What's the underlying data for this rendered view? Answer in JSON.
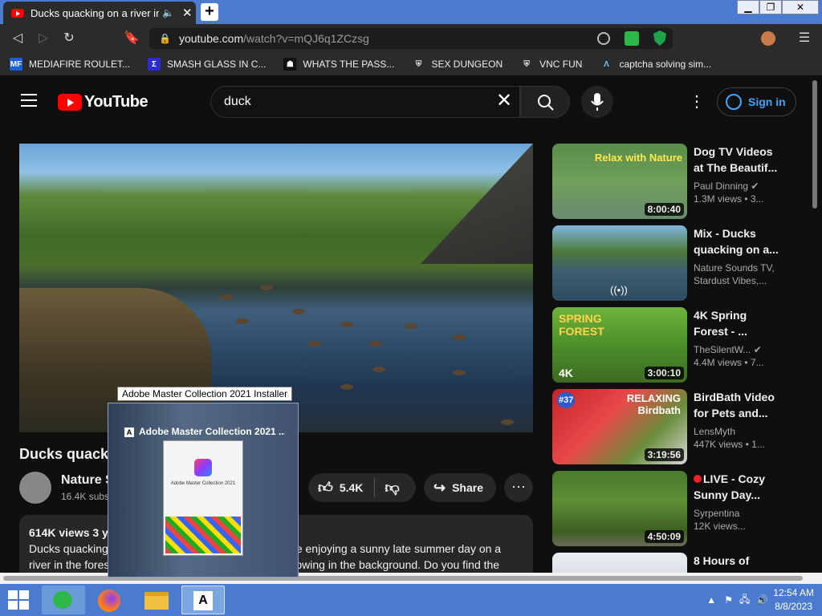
{
  "browser": {
    "tab_title": "Ducks quacking on a river in the forest",
    "url_main": "youtube.com",
    "url_path": "/watch?v=mQJ6q1ZCzsg",
    "bookmarks": [
      {
        "label": "MEDIAFIRE ROULET...",
        "icon": "MF"
      },
      {
        "label": "SMASH GLASS IN C...",
        "icon": "Σ"
      },
      {
        "label": "WHATS THE PASS...",
        "icon": "☗"
      },
      {
        "label": "SEX DUNGEON",
        "icon": "⛨"
      },
      {
        "label": "VNC FUN",
        "icon": "⛨"
      },
      {
        "label": "captcha solving sim...",
        "icon": "Λ"
      }
    ]
  },
  "youtube": {
    "logo_text": "YouTube",
    "search_value": "duck",
    "signin_label": "Sign in",
    "video": {
      "title": "Ducks quack",
      "channel": "Nature S",
      "subs": "16.4K subs",
      "likes": "5.4K",
      "share_label": "Share",
      "views_line": "614K views  3 y",
      "desc_line1": "Ducks quacking",
      "desc_line1b": "hile enjoying a sunny late summer day on a",
      "desc_line2": "river in the fores",
      "desc_line2b": "owing in the background. Do you find the"
    },
    "recommendations": [
      {
        "title": "Dog TV Videos at The Beautif...",
        "channel": "Paul Dinning",
        "views": "1.3M views  • 3...",
        "duration": "8:00:40",
        "overlay": "Relax with Nature",
        "verified": true
      },
      {
        "title": "Mix - Ducks quacking on a...",
        "channel": "Nature Sounds TV,",
        "channel2": "Stardust Vibes,...",
        "duration": "((•))",
        "overlay": ""
      },
      {
        "title": "4K Spring Forest - ...",
        "channel": "TheSilentW...",
        "views": "4.4M views  • 7...",
        "duration": "3:00:10",
        "overlay": "SPRING FOREST",
        "badge": "4K",
        "verified": true
      },
      {
        "title": "BirdBath Video for Pets and...",
        "channel": "LensMyth",
        "views": "447K views  • 1...",
        "duration": "3:19:56",
        "overlay": "RELAXING Birdbath",
        "badge": "#37"
      },
      {
        "title": "LIVE - Cozy Sunny Day...",
        "channel": "Syrpentina",
        "views": "12K views...",
        "duration": "4:50:09",
        "overlay": ""
      },
      {
        "title": "8 Hours of",
        "channel": "",
        "views": "",
        "duration": "",
        "overlay": ""
      }
    ]
  },
  "taskbar": {
    "tooltip": "Adobe Master Collection 2021 Installer",
    "preview_title": "Adobe Master Collection 2021 ...",
    "preview_window_text": "Adobe Master Collection 2021",
    "time": "12:54 AM",
    "date": "8/8/2023"
  }
}
